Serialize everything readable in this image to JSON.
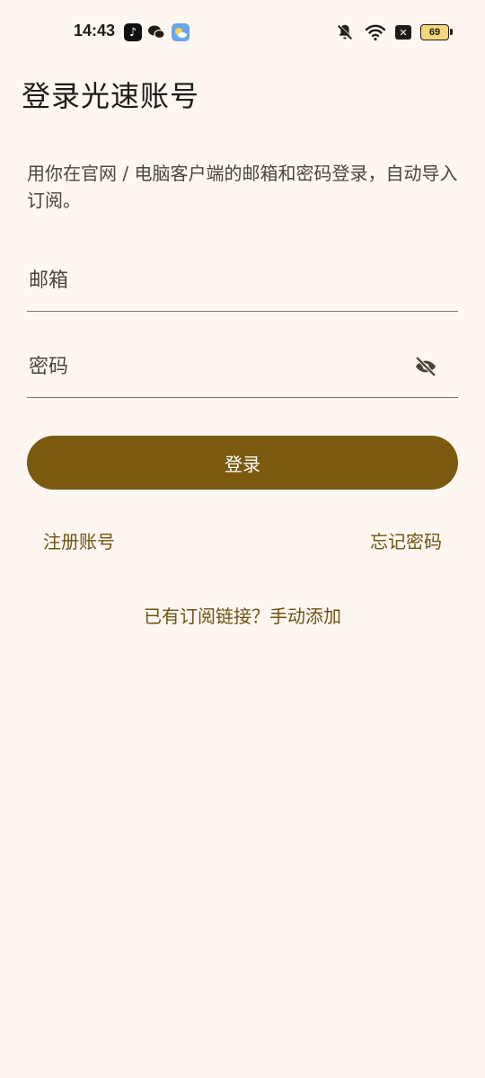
{
  "status_bar": {
    "time": "14:43",
    "battery_level": "69",
    "app_icons": [
      "tiktok-icon",
      "wechat-icon",
      "weather-icon"
    ],
    "status_icons": [
      "mute-bell-icon",
      "wifi-icon",
      "close-box-icon",
      "battery-icon"
    ]
  },
  "page": {
    "title": "登录光速账号",
    "description": "用你在官网 / 电脑客户端的邮箱和密码登录，自动导入订阅。"
  },
  "form": {
    "email_placeholder": "邮箱",
    "email_value": "",
    "password_placeholder": "密码",
    "password_value": "",
    "password_visibility_icon": "eye-off-icon",
    "login_label": "登录"
  },
  "links": {
    "register": "注册账号",
    "forgot_password": "忘记密码",
    "manual_add": "已有订阅链接？手动添加"
  },
  "colors": {
    "background": "#fdf6f1",
    "primary": "#795a0e",
    "link": "#6c5310",
    "text": "#1f1b16"
  }
}
